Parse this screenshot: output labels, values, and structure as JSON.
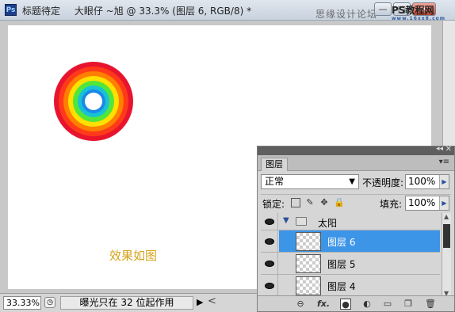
{
  "window": {
    "app_icon": "Ps",
    "doc_prefix": "标题待定",
    "title": "大眼仔 ~旭 @ 33.3% (图层 6, RGB/8) *",
    "forum": "思缘设计论坛",
    "watermark": "PS教程网",
    "watermark_url": "www.16xx8.com",
    "min_label": "—",
    "max_label": "□",
    "close_label": "✕"
  },
  "canvas": {
    "effect_label": "效果如图",
    "ring_colors": [
      "#e8142e",
      "#ff3a1a",
      "#ff7f00",
      "#ffe000",
      "#52e63a",
      "#18c2d6",
      "#1a8ae6",
      "#ffffff"
    ]
  },
  "statusbar": {
    "zoom": "33.33%",
    "message": "曝光只在 32 位起作用",
    "arrow": "▶",
    "scroll_left": "<"
  },
  "layers_panel": {
    "tab": "图层",
    "blend_mode": "正常",
    "opacity_label": "不透明度:",
    "opacity_value": "100%",
    "lock_label": "锁定:",
    "fill_label": "填充:",
    "fill_value": "100%",
    "group_name": "太阳",
    "layers": [
      {
        "name": "图层 6",
        "selected": true
      },
      {
        "name": "图层 5",
        "selected": false
      },
      {
        "name": "图层 4",
        "selected": false
      }
    ],
    "bottom_icons": [
      "link-icon",
      "fx-icon",
      "mask-icon",
      "adjustment-icon",
      "folder-icon",
      "new-layer-icon",
      "trash-icon"
    ],
    "fx_label": "fx."
  }
}
